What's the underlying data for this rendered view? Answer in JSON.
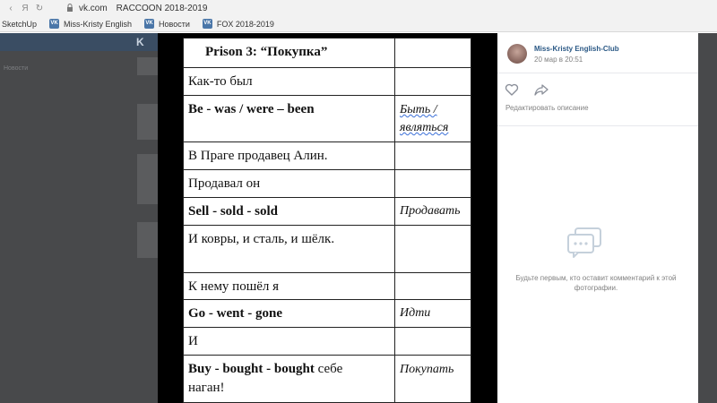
{
  "browser": {
    "nav": {
      "back_glyph": "‹",
      "yandex_glyph": "Я",
      "reload_glyph": "↻",
      "lock_glyph": "🔒"
    },
    "address": {
      "domain": "vk.com",
      "title": "RACCOON 2018-2019"
    },
    "bookmarks": [
      {
        "label": "SketchUp",
        "icon": ""
      },
      {
        "label": "Miss-Kristy English",
        "icon": "vk-icon"
      },
      {
        "label": "Новости",
        "icon": "vk-icon"
      },
      {
        "label": "FOX 2018-2019",
        "icon": "vk-icon"
      }
    ]
  },
  "background": {
    "logo_text": "K",
    "side_label": "Новости"
  },
  "document": {
    "rows": [
      {
        "left": "Prison 3:  “Покупка”",
        "right": "",
        "style": "title"
      },
      {
        "left": "Как-то был",
        "right": ""
      },
      {
        "left": "Be - was / were – been",
        "right_line1": "Быть /",
        "right_line2": "являться",
        "style": "bold"
      },
      {
        "left": "В Праге продавец Алин.",
        "right": ""
      },
      {
        "left": "Продавал он",
        "right": ""
      },
      {
        "left": "Sell - sold - sold",
        "right": "Продавать",
        "style": "bold"
      },
      {
        "left": "И ковры, и сталь, и шёлк.",
        "right": ""
      },
      {
        "left": "К нему пошёл я",
        "right": ""
      },
      {
        "left": "Go - went - gone",
        "right": "Идти",
        "style": "bold"
      },
      {
        "left": "И",
        "right": ""
      },
      {
        "left_bold": "Buy - bought - bought",
        "left_rest": " себе",
        "left_line2": "наган!",
        "right": "Покупать"
      }
    ]
  },
  "panel": {
    "author": "Miss-Kristy English-Club",
    "date": "20 мар в 20:51",
    "edit_description": "Редактировать описание",
    "empty_comments": "Будьте первым, кто оставит комментарий к этой фотографии."
  },
  "colors": {
    "vk_blue": "#4a76a8",
    "link": "#2a5885",
    "muted": "#828282",
    "overlay": "#48494b"
  }
}
